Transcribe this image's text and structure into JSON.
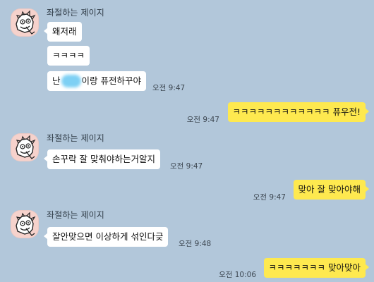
{
  "chat": {
    "groups": [
      {
        "sender": "좌절하는 제이지",
        "messages": [
          {
            "text": "왜저래"
          },
          {
            "text": "ㅋㅋㅋㅋ"
          },
          {
            "text_before": "난",
            "text_after": "이랑 퓨전하꾸야",
            "time": "오전 9:47"
          }
        ]
      },
      {
        "mine": true,
        "messages": [
          {
            "text": "ㅋㅋㅋㅋㅋㅋㅋㅋㅋㅋㅋㅋ 퓨우전!",
            "time": "오전 9:47"
          }
        ]
      },
      {
        "sender": "좌절하는 제이지",
        "messages": [
          {
            "text": "손꾸락 잘 맞춰야하는거알지",
            "time": "오전 9:47"
          }
        ]
      },
      {
        "mine": true,
        "messages": [
          {
            "text": "맞아 잘 맞아야해",
            "time": "오전 9:47"
          }
        ]
      },
      {
        "sender": "좌절하는 제이지",
        "messages": [
          {
            "text": "잘안맞으면 이상하게 섞인다긎",
            "time": "오전 9:48"
          }
        ]
      },
      {
        "mine": true,
        "messages": [
          {
            "text": "ㅋㅋㅋㅋㅋㅋㅋ 맞아맞아",
            "time": "오전 10:06"
          }
        ]
      }
    ]
  },
  "colors": {
    "background": "#b2c7da",
    "incoming_bubble": "#ffffff",
    "outgoing_bubble": "#fee94f",
    "avatar_bg": "#f6d2cc",
    "redaction_blob": "#7dd0f4"
  },
  "icons": {
    "avatar": "cartoon-character-avatar-icon"
  }
}
